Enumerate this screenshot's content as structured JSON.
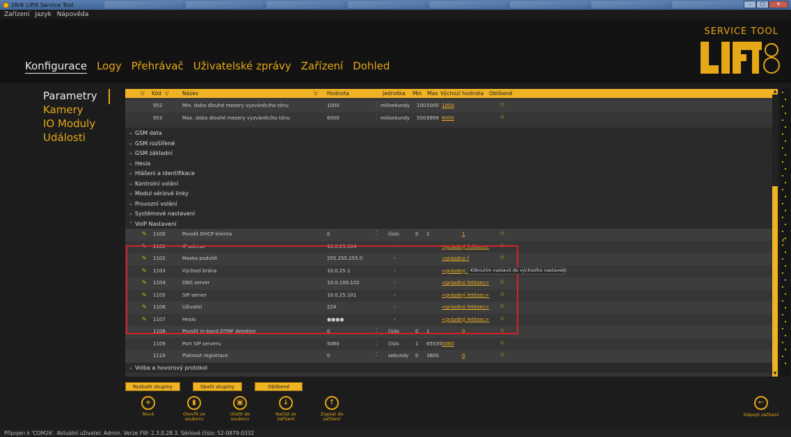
{
  "window": {
    "title": "2N® Lift8 Service Tool",
    "min": "–",
    "max": "□",
    "close": "✕"
  },
  "menu": [
    "Zařízení",
    "Jazyk",
    "Nápověda"
  ],
  "logo": {
    "small": "SERVICE TOOL",
    "big": "LIFT8"
  },
  "nav_tabs": [
    "Konfigurace",
    "Logy",
    "Přehrávač",
    "Uživatelské zprávy",
    "Zařízení",
    "Dohled"
  ],
  "side_nav": [
    "Parametry",
    "Kamery",
    "IO Moduly",
    "Události"
  ],
  "grid": {
    "headers": {
      "code": "Kód",
      "name": "Název",
      "value": "Hodnota",
      "unit": "Jednotka",
      "min": "Min",
      "max": "Max",
      "default": "Výchozí hodnota",
      "fav": "Oblíbené"
    },
    "top_rows": [
      {
        "code": "952",
        "name": "Min. doba dlouhé mezery vyzváněcího tónu",
        "value": "1000",
        "unit": "milisekundy",
        "min": "100",
        "max": "5000",
        "default": "1000"
      },
      {
        "code": "953",
        "name": "Max. doba dlouhé mezery vyzváněcího tónu",
        "value": "6000",
        "unit": "milisekundy",
        "min": "500",
        "max": "9999",
        "default": "6000"
      }
    ],
    "groups": [
      "GSM data",
      "GSM rozšířené",
      "GSM základní",
      "Hesla",
      "Hlášení a identifikace",
      "Kontrolní volání",
      "Modul sériové linky",
      "Provozní volání",
      "Systémové nastavení"
    ],
    "open_group": "VoIP Nastavení",
    "voip_rows": [
      {
        "code": "1100",
        "name": "Povolit DHCP klienta",
        "value": "0",
        "unit": "číslo",
        "min": "0",
        "max": "1",
        "default": "1",
        "spin": true
      },
      {
        "code": "1101",
        "name": "IP adresa",
        "value": "10.0.25.104",
        "unit": "-",
        "min": "",
        "max": "",
        "default": "<prázdný řetězec>",
        "spin": false
      },
      {
        "code": "1102",
        "name": "Maska podsítě",
        "value": "255.255.255.0",
        "unit": "-",
        "min": "",
        "max": "",
        "default": "<prázdný ř",
        "spin": false
      },
      {
        "code": "1103",
        "name": "Výchozí brána",
        "value": "10.0.25.1",
        "unit": "-",
        "min": "",
        "max": "",
        "default": "<prázdný řetězec>",
        "spin": false
      },
      {
        "code": "1104",
        "name": "DNS server",
        "value": "10.0.100.102",
        "unit": "-",
        "min": "",
        "max": "",
        "default": "<prázdný řetězec>",
        "spin": false
      },
      {
        "code": "1105",
        "name": "SIP server",
        "value": "10.0.25.101",
        "unit": "-",
        "min": "",
        "max": "",
        "default": "<prázdný řetězec>",
        "spin": false
      },
      {
        "code": "1106",
        "name": "Uživatel",
        "value": "224",
        "unit": "-",
        "min": "",
        "max": "",
        "default": "<prázdný řetězec>",
        "spin": false
      },
      {
        "code": "1107",
        "name": "Heslo",
        "value": "●●●●",
        "unit": "-",
        "min": "",
        "max": "",
        "default": "<prázdný řetězec>",
        "spin": false
      },
      {
        "code": "1108",
        "name": "Povolit in-band DTMF detektor",
        "value": "0",
        "unit": "číslo",
        "min": "0",
        "max": "1",
        "default": "0",
        "spin": true
      },
      {
        "code": "1109",
        "name": "Port SIP serveru",
        "value": "5060",
        "unit": "číslo",
        "min": "1",
        "max": "65535",
        "default": "5060",
        "spin": true
      },
      {
        "code": "1110",
        "name": "Platnost registrace",
        "value": "0",
        "unit": "sekundy",
        "min": "0",
        "max": "3600",
        "default": "0",
        "spin": true
      }
    ],
    "last_group": "Volba a hovorový protokol",
    "tooltip": "Kliknutím nastavit do výchozího nastavení."
  },
  "group_buttons": [
    "Rozbalit skupiny",
    "Sbalit skupiny",
    "Oblíbené"
  ],
  "actions": [
    {
      "icon": "+",
      "label": "Nová"
    },
    {
      "icon": "▮",
      "label": "Otevřít ze souboru"
    },
    {
      "icon": "▣",
      "label": "Uložit do souboru"
    },
    {
      "icon": "↓",
      "label": "Načíst ze zařízení"
    },
    {
      "icon": "↑",
      "label": "Zapsat do zařízení"
    }
  ],
  "disconnect": {
    "icon": "←",
    "label": "Odpojit zařízení"
  },
  "status": "Připojen k 'COM26'. Aktuální uživatel: Admin. Verze FW: 2.3.0.28.3. Sériové číslo: 52-0879-0332"
}
